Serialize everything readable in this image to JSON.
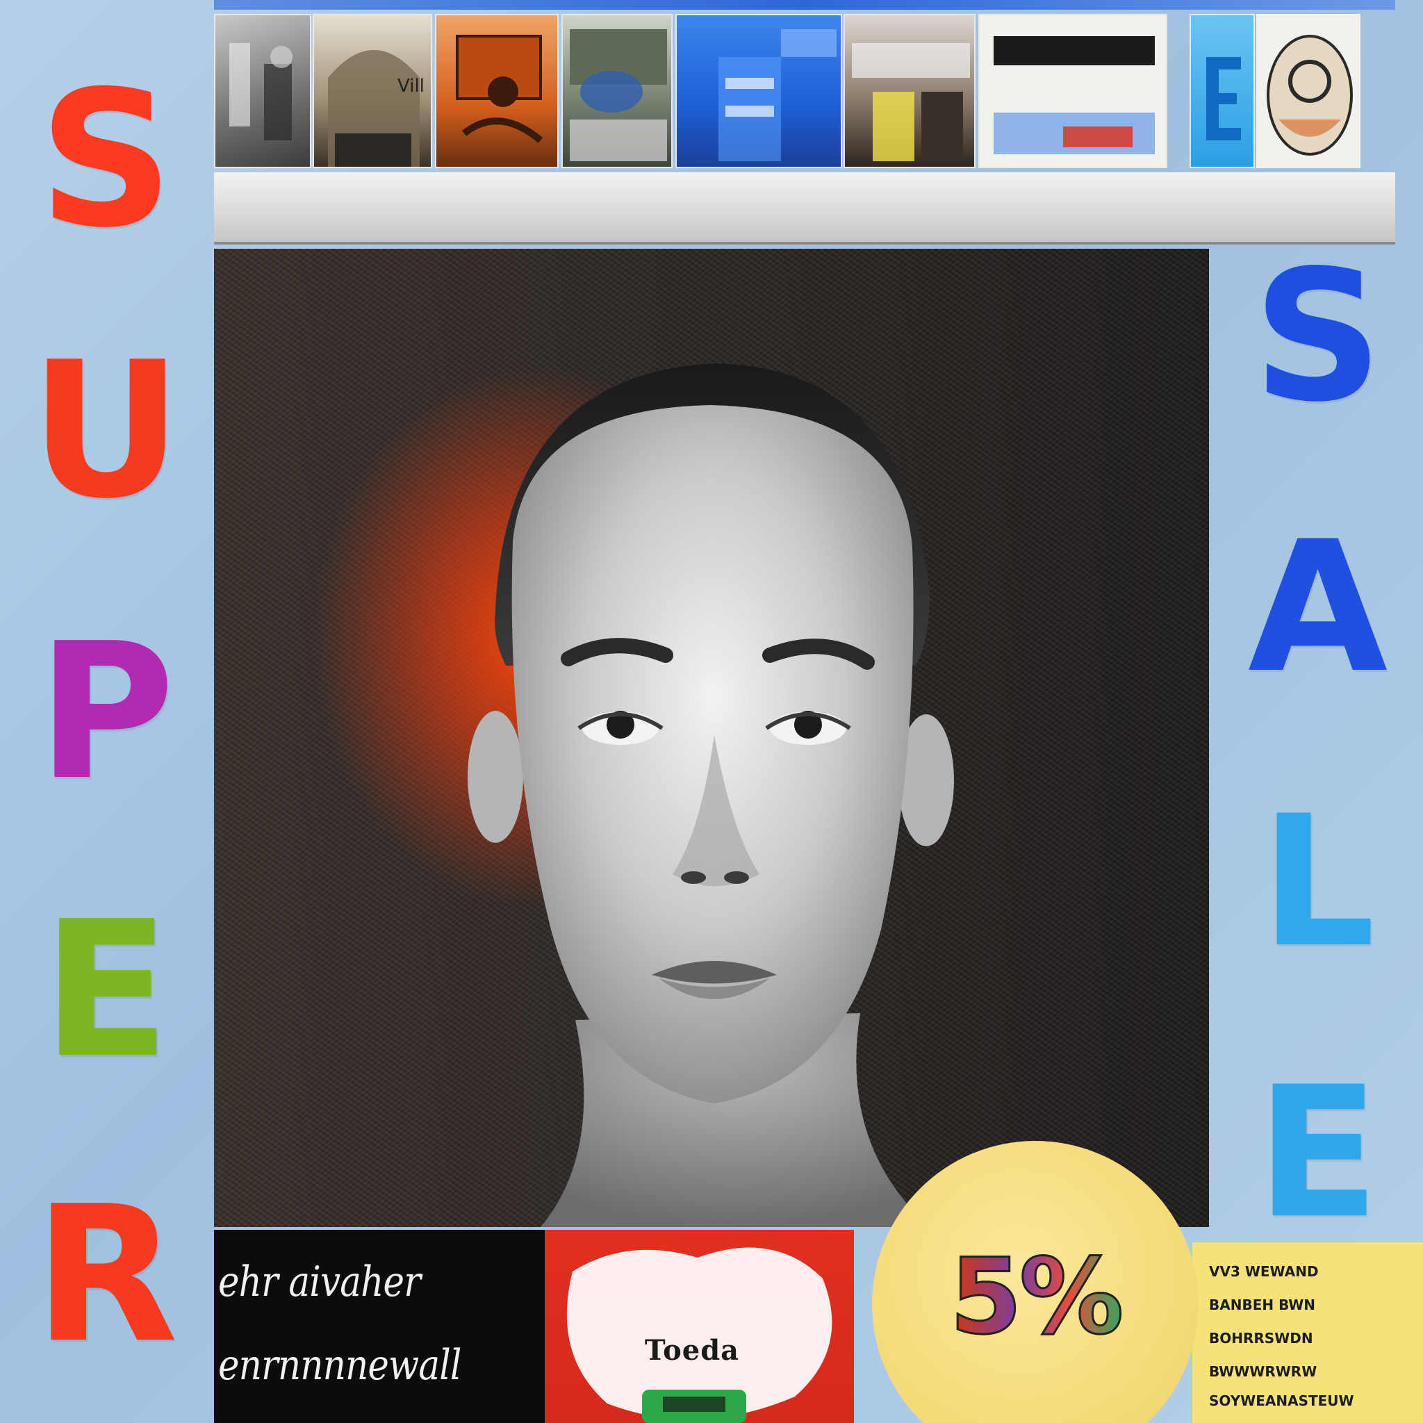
{
  "poster": {
    "left_word": [
      "S",
      "U",
      "P",
      "E",
      "R"
    ],
    "right_word": [
      "S",
      "A",
      "L",
      "E"
    ],
    "left_colors": [
      "#fa3b20",
      "#f43b22",
      "#b12bb0",
      "#7fb524",
      "#f53a21"
    ],
    "right_colors": [
      "#1f4fe0",
      "#1f50e0",
      "#2fa8ec",
      "#2fa7ea"
    ],
    "discount": "5%",
    "product_label": "Toeda",
    "black_panel_lines": [
      "ehr aivaher",
      "enrnnnnewall"
    ],
    "yellow_panel_lines": [
      "VV3 WEWAND",
      "BANBEH BWN",
      "BOHRRSWDN",
      "BWWWRWRW",
      "SOYWEANASTEUW"
    ],
    "shelf_items": [
      {
        "name": "shelf-thumb-street",
        "color": "#8d8d8d"
      },
      {
        "name": "shelf-thumb-arch",
        "color": "#8b7a62"
      },
      {
        "name": "shelf-thumb-orange-box",
        "color": "#d9661f"
      },
      {
        "name": "shelf-thumb-desk",
        "color": "#6e7a6a"
      },
      {
        "name": "shelf-thumb-blue-aisle",
        "color": "#2a6fe0"
      },
      {
        "name": "shelf-thumb-storefront",
        "color": "#7d6a58"
      },
      {
        "name": "shelf-thumb-sign-board",
        "color": "#ececec"
      },
      {
        "name": "shelf-thumb-blue-letter",
        "color": "#2fa8e8"
      },
      {
        "name": "shelf-thumb-round-logo",
        "color": "#e8ddcd"
      }
    ]
  }
}
